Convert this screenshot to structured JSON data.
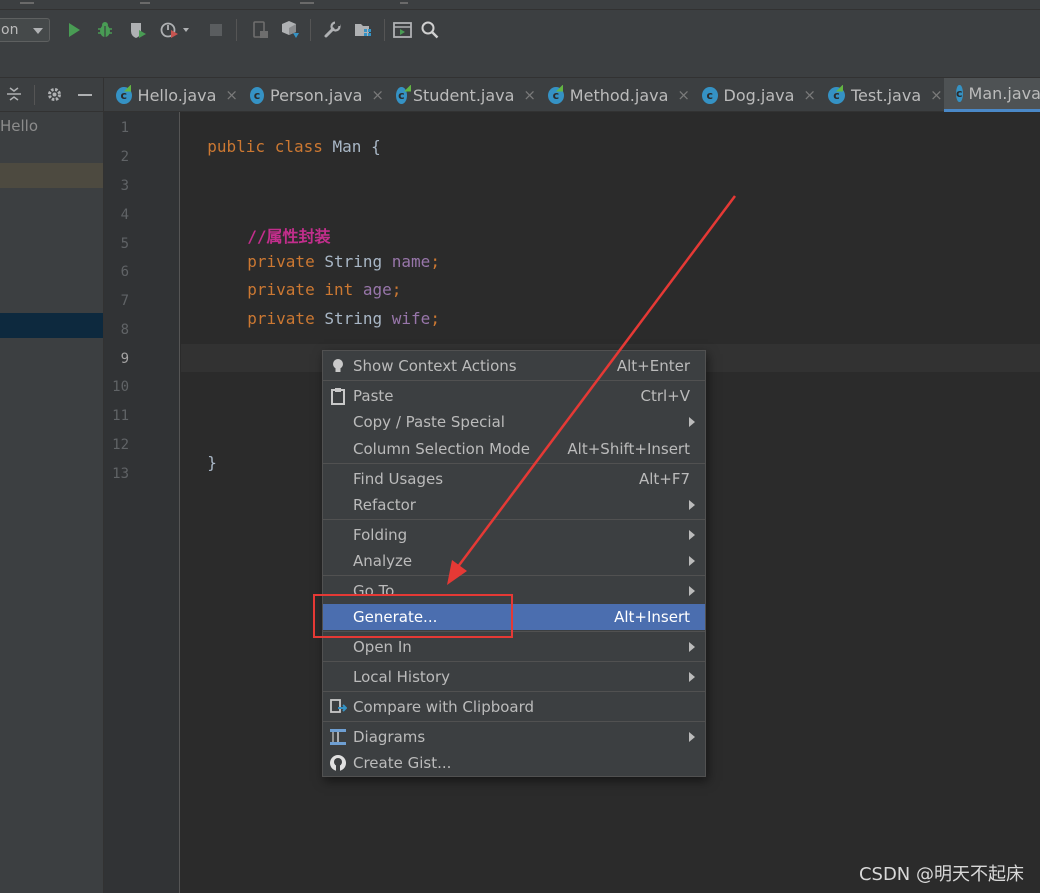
{
  "toolbar": {
    "run_config_label": "on"
  },
  "project_pane": {
    "item_label": "Hello"
  },
  "tabs": [
    {
      "label": "Hello.java",
      "active": false
    },
    {
      "label": "Person.java",
      "active": false
    },
    {
      "label": "Student.java",
      "active": false
    },
    {
      "label": "Method.java",
      "active": false
    },
    {
      "label": "Dog.java",
      "active": false
    },
    {
      "label": "Test.java",
      "active": false
    },
    {
      "label": "Man.java",
      "active": true
    }
  ],
  "editor": {
    "line_numbers": [
      "1",
      "2",
      "3",
      "4",
      "5",
      "6",
      "7",
      "8",
      "9",
      "10",
      "11",
      "12",
      "13"
    ],
    "code": {
      "l1": {
        "kw1": "public",
        "kw2": "class",
        "name": "Man",
        "brace": "{"
      },
      "l4": {
        "comment": "//属性封装"
      },
      "l5": {
        "kw": "private",
        "type": "String",
        "field": "name",
        "semi": ";"
      },
      "l6": {
        "kw": "private",
        "type": "int",
        "field": "age",
        "semi": ";"
      },
      "l7": {
        "kw": "private",
        "type": "String",
        "field": "wife",
        "semi": ";"
      },
      "l12": {
        "brace": "}"
      }
    }
  },
  "context_menu": {
    "items": [
      {
        "label": "Show Context Actions",
        "shortcut": "Alt+Enter",
        "icon": "lightbulb-icon"
      },
      {
        "label": "Paste",
        "shortcut": "Ctrl+V",
        "icon": "clipboard-icon"
      },
      {
        "label": "Copy / Paste Special",
        "shortcut": "",
        "submenu": true
      },
      {
        "label": "Column Selection Mode",
        "shortcut": "Alt+Shift+Insert"
      },
      {
        "label": "Find Usages",
        "shortcut": "Alt+F7"
      },
      {
        "label": "Refactor",
        "shortcut": "",
        "submenu": true
      },
      {
        "label": "Folding",
        "shortcut": "",
        "submenu": true
      },
      {
        "label": "Analyze",
        "shortcut": "",
        "submenu": true
      },
      {
        "label": "Go To",
        "shortcut": "",
        "submenu": true
      },
      {
        "label": "Generate...",
        "shortcut": "Alt+Insert",
        "selected": true
      },
      {
        "label": "Open In",
        "shortcut": "",
        "submenu": true
      },
      {
        "label": "Local History",
        "shortcut": "",
        "submenu": true
      },
      {
        "label": "Compare with Clipboard",
        "shortcut": "",
        "icon": "compare-icon"
      },
      {
        "label": "Diagrams",
        "shortcut": "",
        "submenu": true,
        "icon": "diagram-icon"
      },
      {
        "label": "Create Gist...",
        "shortcut": "",
        "icon": "github-icon"
      }
    ]
  },
  "watermark": "CSDN @明天不起床",
  "colors": {
    "annotation_red": "#e53935",
    "selection_blue": "#4b6eaf",
    "keyword": "#cc7832",
    "field": "#9876aa",
    "comment": "#c22e8c"
  }
}
